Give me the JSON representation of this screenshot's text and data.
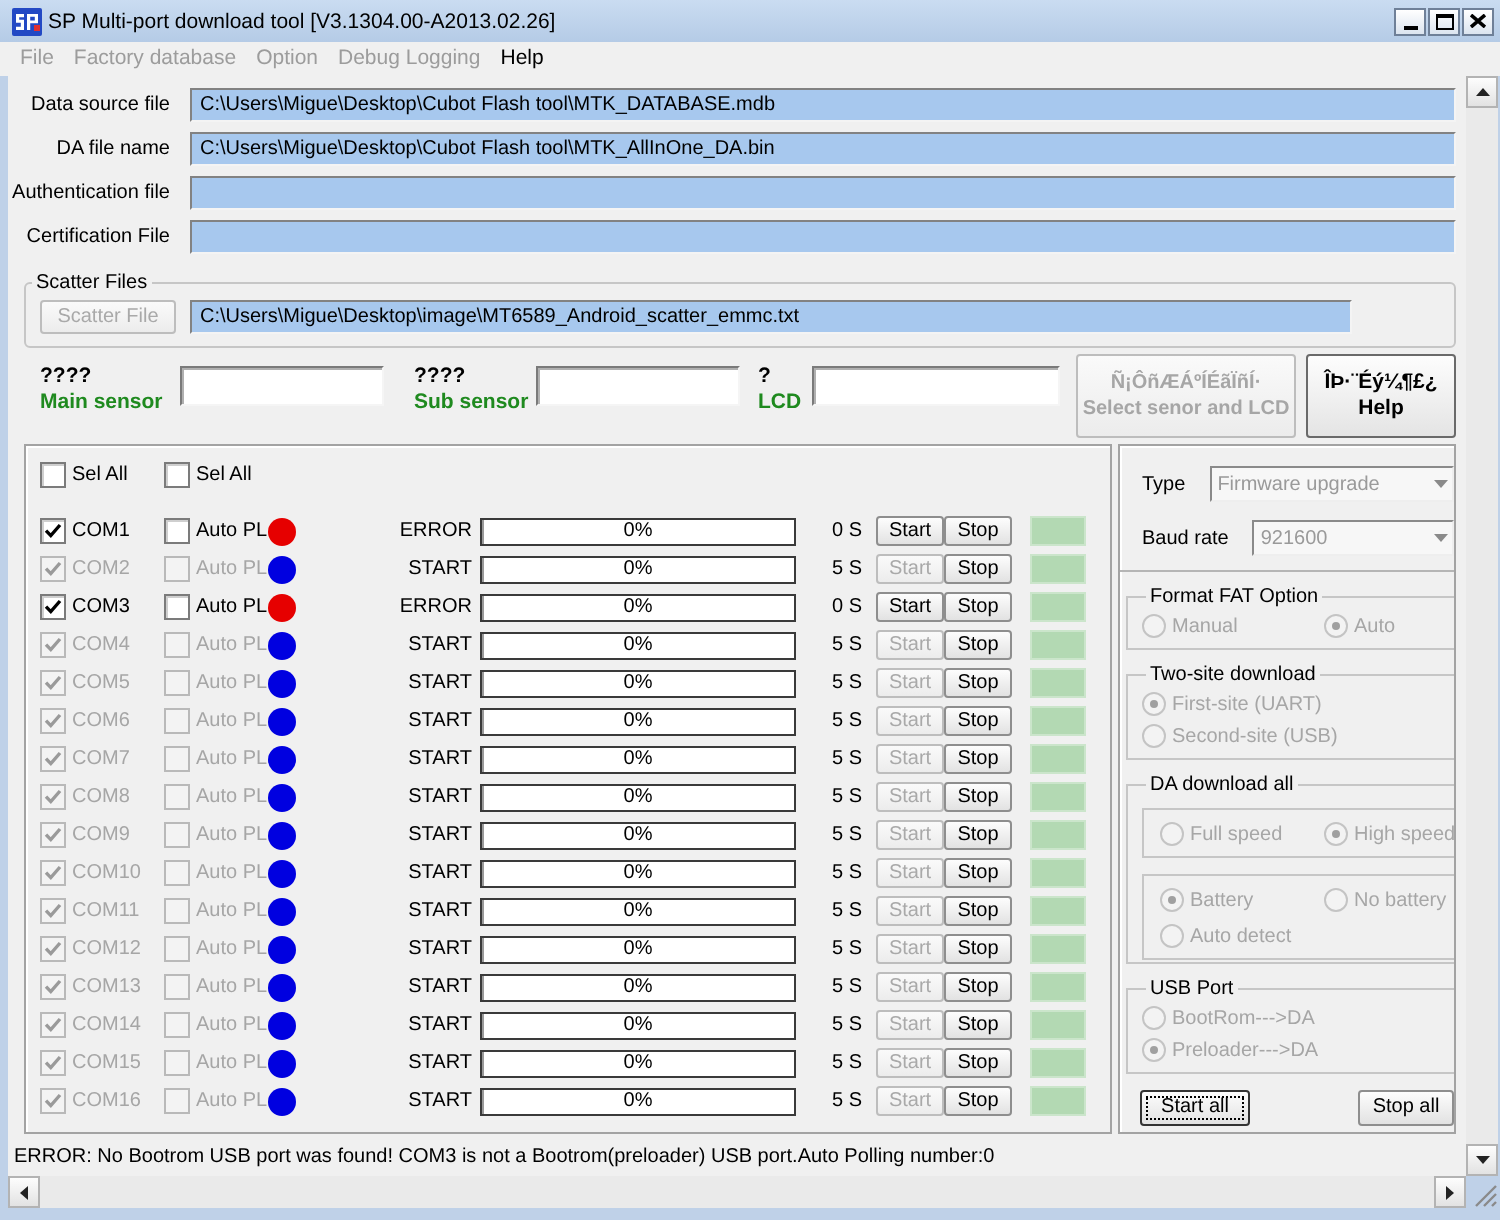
{
  "window": {
    "title": "SP Multi-port download tool [V3.1304.00-A2013.02.26]"
  },
  "menu": [
    {
      "label": "File",
      "disabled": true
    },
    {
      "label": "Factory database",
      "disabled": true
    },
    {
      "label": "Option",
      "disabled": true
    },
    {
      "label": "Debug Logging",
      "disabled": true
    },
    {
      "label": "Help",
      "disabled": false
    }
  ],
  "files": [
    {
      "label": "Data source file",
      "value": "C:\\Users\\Migue\\Desktop\\Cubot Flash tool\\MTK_DATABASE.mdb"
    },
    {
      "label": "DA file name",
      "value": "C:\\Users\\Migue\\Desktop\\Cubot Flash tool\\MTK_AllInOne_DA.bin"
    },
    {
      "label": "Authentication file"
    },
    {
      "label": "Certification File"
    }
  ],
  "scatter": {
    "title": "Scatter Files",
    "button": {
      "label": "Scatter File",
      "disabled": true
    },
    "value": "C:\\Users\\Migue\\Desktop\\image\\MT6589_Android_scatter_emmc.txt"
  },
  "sensors": [
    {
      "code": "????",
      "label": "Main sensor"
    },
    {
      "code": "????",
      "label": "Sub sensor"
    },
    {
      "code": "?",
      "label": "LCD"
    }
  ],
  "sensor_buttons": [
    {
      "kind": "select",
      "lines": [
        "Ñ¡ÔñÆÁºÍÉãÏñÍ·",
        "Select senor and LCD"
      ],
      "disabled": true
    },
    {
      "kind": "help",
      "lines": [
        "ÎÞ·¨Éý¼¶£¿",
        "Help"
      ],
      "disabled": false
    }
  ],
  "ports": {
    "select_all": [
      {
        "label": "Sel All",
        "checked": false
      },
      {
        "label": "Sel All",
        "checked": false
      }
    ],
    "rows": [
      {
        "name": "COM1",
        "checked": true,
        "disabled": false,
        "auto_label": "Auto PL",
        "auto_checked": false,
        "color": "#e60000",
        "status": "ERROR",
        "level": 0,
        "progress": "0%",
        "time": "0 S",
        "start": "Start",
        "stop": "Stop"
      },
      {
        "name": "COM2",
        "checked": true,
        "disabled": true,
        "auto_label": "Auto PL",
        "auto_checked": false,
        "color": "#0000e0",
        "status": "START",
        "level": 0,
        "progress": "0%",
        "time": "5 S",
        "start": "Start",
        "stop": "Stop"
      },
      {
        "name": "COM3",
        "checked": true,
        "disabled": false,
        "auto_label": "Auto PL",
        "auto_checked": false,
        "color": "#e60000",
        "status": "ERROR",
        "level": 0,
        "progress": "0%",
        "time": "0 S",
        "start": "Start",
        "stop": "Stop"
      },
      {
        "name": "COM4",
        "checked": true,
        "disabled": true,
        "auto_label": "Auto PL",
        "auto_checked": false,
        "color": "#0000e0",
        "status": "START",
        "level": 0,
        "progress": "0%",
        "time": "5 S",
        "start": "Start",
        "stop": "Stop"
      },
      {
        "name": "COM5",
        "checked": true,
        "disabled": true,
        "auto_label": "Auto PL",
        "auto_checked": false,
        "color": "#0000e0",
        "status": "START",
        "level": 0,
        "progress": "0%",
        "time": "5 S",
        "start": "Start",
        "stop": "Stop"
      },
      {
        "name": "COM6",
        "checked": true,
        "disabled": true,
        "auto_label": "Auto PL",
        "auto_checked": false,
        "color": "#0000e0",
        "status": "START",
        "level": 0,
        "progress": "0%",
        "time": "5 S",
        "start": "Start",
        "stop": "Stop"
      },
      {
        "name": "COM7",
        "checked": true,
        "disabled": true,
        "auto_label": "Auto PL",
        "auto_checked": false,
        "color": "#0000e0",
        "status": "START",
        "level": 0,
        "progress": "0%",
        "time": "5 S",
        "start": "Start",
        "stop": "Stop"
      },
      {
        "name": "COM8",
        "checked": true,
        "disabled": true,
        "auto_label": "Auto PL",
        "auto_checked": false,
        "color": "#0000e0",
        "status": "START",
        "level": 0,
        "progress": "0%",
        "time": "5 S",
        "start": "Start",
        "stop": "Stop"
      },
      {
        "name": "COM9",
        "checked": true,
        "disabled": true,
        "auto_label": "Auto PL",
        "auto_checked": false,
        "color": "#0000e0",
        "status": "START",
        "level": 0,
        "progress": "0%",
        "time": "5 S",
        "start": "Start",
        "stop": "Stop"
      },
      {
        "name": "COM10",
        "checked": true,
        "disabled": true,
        "auto_label": "Auto PL",
        "auto_checked": false,
        "color": "#0000e0",
        "status": "START",
        "level": 0,
        "progress": "0%",
        "time": "5 S",
        "start": "Start",
        "stop": "Stop"
      },
      {
        "name": "COM11",
        "checked": true,
        "disabled": true,
        "auto_label": "Auto PL",
        "auto_checked": false,
        "color": "#0000e0",
        "status": "START",
        "level": 0,
        "progress": "0%",
        "time": "5 S",
        "start": "Start",
        "stop": "Stop"
      },
      {
        "name": "COM12",
        "checked": true,
        "disabled": true,
        "auto_label": "Auto PL",
        "auto_checked": false,
        "color": "#0000e0",
        "status": "START",
        "level": 0,
        "progress": "0%",
        "time": "5 S",
        "start": "Start",
        "stop": "Stop"
      },
      {
        "name": "COM13",
        "checked": true,
        "disabled": true,
        "auto_label": "Auto PL",
        "auto_checked": false,
        "color": "#0000e0",
        "status": "START",
        "level": 0,
        "progress": "0%",
        "time": "5 S",
        "start": "Start",
        "stop": "Stop"
      },
      {
        "name": "COM14",
        "checked": true,
        "disabled": true,
        "auto_label": "Auto PL",
        "auto_checked": false,
        "color": "#0000e0",
        "status": "START",
        "level": 0,
        "progress": "0%",
        "time": "5 S",
        "start": "Start",
        "stop": "Stop"
      },
      {
        "name": "COM15",
        "checked": true,
        "disabled": true,
        "auto_label": "Auto PL",
        "auto_checked": false,
        "color": "#0000e0",
        "status": "START",
        "level": 0,
        "progress": "0%",
        "time": "5 S",
        "start": "Start",
        "stop": "Stop"
      },
      {
        "name": "COM16",
        "checked": true,
        "disabled": true,
        "auto_label": "Auto PL",
        "auto_checked": false,
        "color": "#0000e0",
        "status": "START",
        "level": 0,
        "progress": "0%",
        "time": "5 S",
        "start": "Start",
        "stop": "Stop"
      }
    ]
  },
  "options": {
    "fields": [
      {
        "label": "Type",
        "value": "Firmware upgrade",
        "disabled": true
      },
      {
        "label": "Baud rate",
        "value": "921600",
        "disabled": true
      }
    ],
    "groups": [
      {
        "title": "Format FAT Option",
        "disabled": true,
        "rows": [
          [
            {
              "label": "Manual",
              "selected": false
            },
            {
              "label": "Auto",
              "selected": true
            }
          ]
        ]
      },
      {
        "title": "Two-site download",
        "disabled": true,
        "rows": [
          [
            {
              "label": "First-site (UART)",
              "selected": true
            }
          ],
          [
            {
              "label": "Second-site (USB)",
              "selected": false
            }
          ]
        ]
      },
      {
        "title": "DA download all",
        "disabled": true,
        "subgroups": [
          {
            "rows": [
              [
                {
                  "label": "Full speed",
                  "selected": false
                },
                {
                  "label": "High speed",
                  "selected": true
                }
              ]
            ]
          },
          {
            "rows": [
              [
                {
                  "label": "Battery",
                  "selected": true
                },
                {
                  "label": "No battery",
                  "selected": false
                }
              ],
              [
                {
                  "label": "Auto detect",
                  "selected": false
                }
              ]
            ]
          }
        ]
      },
      {
        "title": "USB Port",
        "disabled": true,
        "rows": [
          [
            {
              "label": "BootRom--->DA",
              "selected": false
            }
          ],
          [
            {
              "label": "Preloader--->DA",
              "selected": true
            }
          ]
        ]
      }
    ],
    "buttons": [
      {
        "label": "Start all",
        "focused": true
      },
      {
        "label": "Stop all",
        "focused": false
      }
    ]
  },
  "status_bar": {
    "text": "ERROR: No Bootrom USB port was found! COM3 is not a Bootrom(preloader) USB port.Auto Polling number:0"
  }
}
